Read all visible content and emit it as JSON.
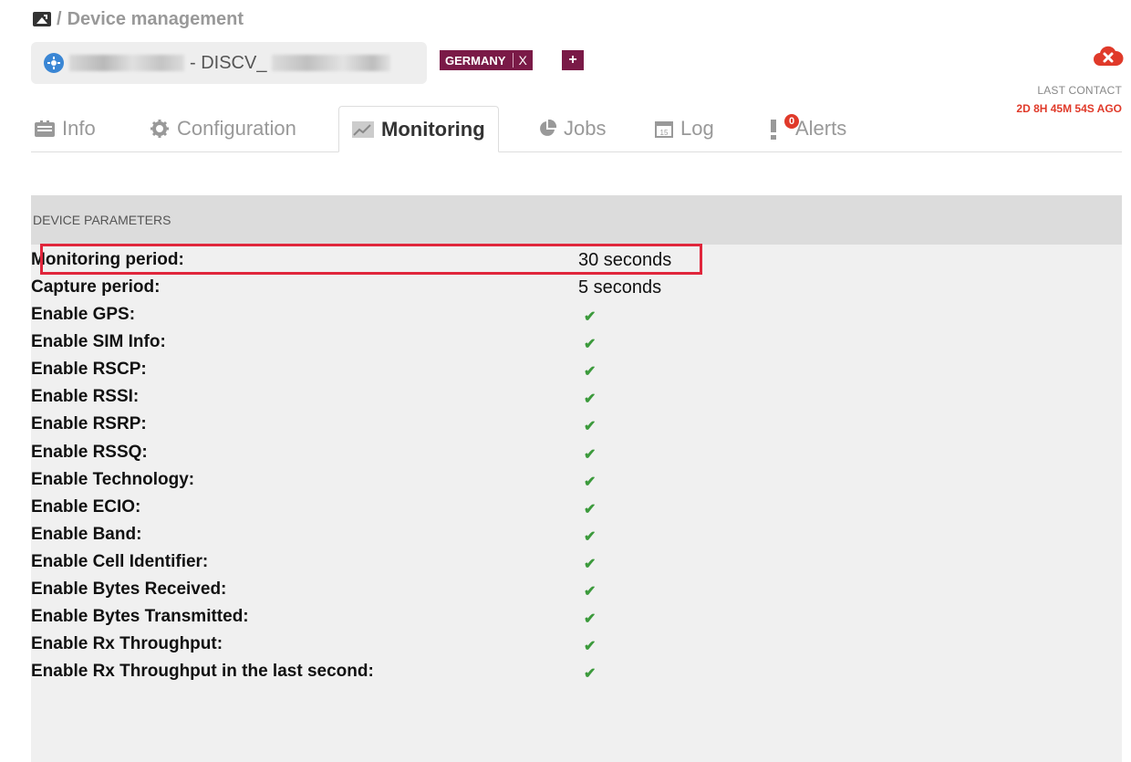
{
  "breadcrumb": {
    "separator": "/",
    "title": "Device management"
  },
  "device": {
    "prefix": "- DISCV_"
  },
  "tags": [
    {
      "label": "GERMANY",
      "remove": "X"
    }
  ],
  "tag_add": "+",
  "status": {
    "last_contact_label": "LAST CONTACT",
    "last_contact_value": "2D 8H 45M 54S AGO",
    "status_color": "#e03a2a"
  },
  "tabs": [
    {
      "label": "Info",
      "icon": "id-card-icon",
      "active": false
    },
    {
      "label": "Configuration",
      "icon": "gear-icon",
      "active": false
    },
    {
      "label": "Monitoring",
      "icon": "chart-icon",
      "active": true
    },
    {
      "label": "Jobs",
      "icon": "pie-chart-icon",
      "active": false
    },
    {
      "label": "Log",
      "icon": "calendar-icon",
      "active": false
    },
    {
      "label": "Alerts",
      "icon": "exclamation-icon",
      "active": false,
      "badge": "0"
    }
  ],
  "parameters": {
    "header": "DEVICE PARAMETERS",
    "check_glyph": "✔",
    "rows": [
      {
        "label": "Monitoring period:",
        "value": "30 seconds"
      },
      {
        "label": "Capture period:",
        "value": "5 seconds"
      },
      {
        "label": "Enable GPS:",
        "value": "✔"
      },
      {
        "label": "Enable SIM Info:",
        "value": "✔"
      },
      {
        "label": "Enable RSCP:",
        "value": "✔"
      },
      {
        "label": "Enable RSSI:",
        "value": "✔"
      },
      {
        "label": "Enable RSRP:",
        "value": "✔"
      },
      {
        "label": "Enable RSSQ:",
        "value": "✔"
      },
      {
        "label": "Enable Technology:",
        "value": "✔"
      },
      {
        "label": "Enable ECIO:",
        "value": "✔"
      },
      {
        "label": "Enable Band:",
        "value": "✔"
      },
      {
        "label": "Enable Cell Identifier:",
        "value": "✔"
      },
      {
        "label": "Enable Bytes Received:",
        "value": "✔"
      },
      {
        "label": "Enable Bytes Transmitted:",
        "value": "✔"
      },
      {
        "label": "Enable Rx Throughput:",
        "value": "✔"
      },
      {
        "label": "Enable Rx Throughput in the last second:",
        "value": "✔"
      }
    ]
  },
  "colors": {
    "accent_tag": "#7a1a47",
    "check": "#3c9a3c",
    "highlight": "#e0263c"
  }
}
